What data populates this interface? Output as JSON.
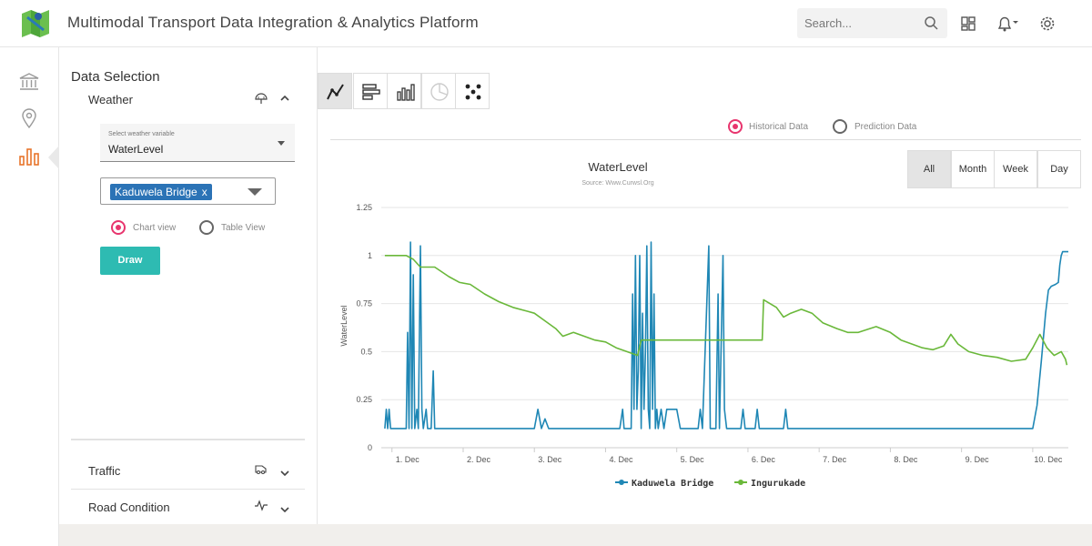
{
  "header": {
    "title": "Multimodal Transport Data Integration & Analytics Platform",
    "search_placeholder": "Search...",
    "icons": [
      "map-logo-icon",
      "search-icon",
      "dashboard-icon",
      "bell-icon",
      "gear-icon"
    ]
  },
  "rail": {
    "items": [
      {
        "icon": "bank-icon",
        "active": false
      },
      {
        "icon": "location-pin-icon",
        "active": false
      },
      {
        "icon": "bar-chart-icon",
        "active": true
      }
    ],
    "active_color": "#e8752b"
  },
  "panel": {
    "title": "Data Selection",
    "sections": [
      {
        "label": "Weather",
        "icon": "umbrella-icon",
        "expanded": true
      },
      {
        "label": "Traffic",
        "icon": "traffic-icon",
        "expanded": false
      },
      {
        "label": "Road Condition",
        "icon": "pulse-icon",
        "expanded": false
      }
    ],
    "variable_label": "Select weather variable",
    "variable_value": "WaterLevel",
    "selected_location": "Kaduwela Bridge",
    "chip_remove": "x",
    "view_options": [
      "Chart view",
      "Table View"
    ],
    "selected_view": "Chart view",
    "draw_label": "Draw"
  },
  "toolbar": {
    "chart_types": [
      "line-chart-icon",
      "horizontal-bar-icon",
      "bar-chart-icon",
      "pie-chart-icon",
      "scatter-icon"
    ],
    "active": "line-chart-icon"
  },
  "data_modes": [
    "Historical Data",
    "Prediction Data"
  ],
  "selected_mode": "Historical Data",
  "ranges": [
    "All",
    "Month",
    "Week",
    "Day"
  ],
  "selected_range": "All",
  "chart_data": {
    "type": "line",
    "title": "WaterLevel",
    "subtitle": "Source: Www.Curwsl.Org",
    "ylabel": "WaterLevel",
    "xlabel": "",
    "ylim": [
      0,
      1.25
    ],
    "y_ticks": [
      "0",
      "0.25",
      "0.5",
      "0.75",
      "1",
      "1.25"
    ],
    "x_ticks": [
      "1. Dec",
      "2. Dec",
      "3. Dec",
      "4. Dec",
      "5. Dec",
      "6. Dec",
      "7. Dec",
      "8. Dec",
      "9. Dec",
      "10. Dec"
    ],
    "x_range": [
      0.85,
      10.5
    ],
    "legend_position": "bottom-center",
    "grid": true,
    "series": [
      {
        "name": "Kaduwela Bridge",
        "color": "#1f87b5",
        "points": [
          [
            0.9,
            0.1
          ],
          [
            0.92,
            0.2
          ],
          [
            0.94,
            0.1
          ],
          [
            0.96,
            0.2
          ],
          [
            0.98,
            0.1
          ],
          [
            1.2,
            0.1
          ],
          [
            1.22,
            0.6
          ],
          [
            1.24,
            0.1
          ],
          [
            1.26,
            1.07
          ],
          [
            1.28,
            0.1
          ],
          [
            1.3,
            0.9
          ],
          [
            1.32,
            0.1
          ],
          [
            1.35,
            0.2
          ],
          [
            1.37,
            0.1
          ],
          [
            1.4,
            1.05
          ],
          [
            1.42,
            0.2
          ],
          [
            1.44,
            0.1
          ],
          [
            1.48,
            0.2
          ],
          [
            1.5,
            0.1
          ],
          [
            1.55,
            0.1
          ],
          [
            1.58,
            0.4
          ],
          [
            1.6,
            0.1
          ],
          [
            2.1,
            0.1
          ],
          [
            3.0,
            0.1
          ],
          [
            3.05,
            0.2
          ],
          [
            3.1,
            0.1
          ],
          [
            3.15,
            0.15
          ],
          [
            3.2,
            0.1
          ],
          [
            4.2,
            0.1
          ],
          [
            4.24,
            0.2
          ],
          [
            4.26,
            0.1
          ],
          [
            4.36,
            0.1
          ],
          [
            4.38,
            0.8
          ],
          [
            4.4,
            0.2
          ],
          [
            4.42,
            1.0
          ],
          [
            4.44,
            0.2
          ],
          [
            4.46,
            0.4
          ],
          [
            4.48,
            1.0
          ],
          [
            4.5,
            0.1
          ],
          [
            4.52,
            0.7
          ],
          [
            4.54,
            0.2
          ],
          [
            4.56,
            0.5
          ],
          [
            4.58,
            1.05
          ],
          [
            4.6,
            0.2
          ],
          [
            4.62,
            0.1
          ],
          [
            4.64,
            1.07
          ],
          [
            4.66,
            0.2
          ],
          [
            4.68,
            0.8
          ],
          [
            4.7,
            0.1
          ],
          [
            4.72,
            0.2
          ],
          [
            4.74,
            0.1
          ],
          [
            4.78,
            0.2
          ],
          [
            4.82,
            0.1
          ],
          [
            4.86,
            0.2
          ],
          [
            5.0,
            0.2
          ],
          [
            5.05,
            0.1
          ],
          [
            5.3,
            0.1
          ],
          [
            5.33,
            0.2
          ],
          [
            5.36,
            0.1
          ],
          [
            5.45,
            1.05
          ],
          [
            5.47,
            0.1
          ],
          [
            5.55,
            0.1
          ],
          [
            5.58,
            0.8
          ],
          [
            5.6,
            0.1
          ],
          [
            5.65,
            1.0
          ],
          [
            5.67,
            0.2
          ],
          [
            5.7,
            0.1
          ],
          [
            5.9,
            0.1
          ],
          [
            5.93,
            0.2
          ],
          [
            5.96,
            0.1
          ],
          [
            6.1,
            0.1
          ],
          [
            6.13,
            0.2
          ],
          [
            6.16,
            0.1
          ],
          [
            6.5,
            0.1
          ],
          [
            6.53,
            0.2
          ],
          [
            6.56,
            0.1
          ],
          [
            10.0,
            0.1
          ],
          [
            10.06,
            0.22
          ],
          [
            10.12,
            0.45
          ],
          [
            10.18,
            0.7
          ],
          [
            10.22,
            0.82
          ],
          [
            10.26,
            0.84
          ],
          [
            10.32,
            0.85
          ],
          [
            10.36,
            0.86
          ],
          [
            10.38,
            0.95
          ],
          [
            10.4,
            1.0
          ],
          [
            10.42,
            1.02
          ],
          [
            10.5,
            1.02
          ]
        ]
      },
      {
        "name": "Ingurukade",
        "color": "#6ab83a",
        "points": [
          [
            0.9,
            1.0
          ],
          [
            1.2,
            1.0
          ],
          [
            1.3,
            0.98
          ],
          [
            1.4,
            0.94
          ],
          [
            1.6,
            0.94
          ],
          [
            1.8,
            0.89
          ],
          [
            1.95,
            0.86
          ],
          [
            2.1,
            0.85
          ],
          [
            2.3,
            0.8
          ],
          [
            2.5,
            0.76
          ],
          [
            2.7,
            0.73
          ],
          [
            2.9,
            0.71
          ],
          [
            3.0,
            0.7
          ],
          [
            3.15,
            0.66
          ],
          [
            3.3,
            0.62
          ],
          [
            3.4,
            0.58
          ],
          [
            3.55,
            0.6
          ],
          [
            3.7,
            0.58
          ],
          [
            3.85,
            0.56
          ],
          [
            4.0,
            0.55
          ],
          [
            4.15,
            0.52
          ],
          [
            4.3,
            0.5
          ],
          [
            4.45,
            0.48
          ],
          [
            4.5,
            0.56
          ],
          [
            6.2,
            0.56
          ],
          [
            6.22,
            0.77
          ],
          [
            6.4,
            0.73
          ],
          [
            6.5,
            0.68
          ],
          [
            6.6,
            0.7
          ],
          [
            6.75,
            0.72
          ],
          [
            6.9,
            0.7
          ],
          [
            7.05,
            0.65
          ],
          [
            7.25,
            0.62
          ],
          [
            7.4,
            0.6
          ],
          [
            7.55,
            0.6
          ],
          [
            7.8,
            0.63
          ],
          [
            8.0,
            0.6
          ],
          [
            8.15,
            0.56
          ],
          [
            8.3,
            0.54
          ],
          [
            8.45,
            0.52
          ],
          [
            8.6,
            0.51
          ],
          [
            8.75,
            0.53
          ],
          [
            8.85,
            0.59
          ],
          [
            8.95,
            0.54
          ],
          [
            9.1,
            0.5
          ],
          [
            9.3,
            0.48
          ],
          [
            9.5,
            0.47
          ],
          [
            9.7,
            0.45
          ],
          [
            9.9,
            0.46
          ],
          [
            10.0,
            0.52
          ],
          [
            10.1,
            0.59
          ],
          [
            10.2,
            0.52
          ],
          [
            10.3,
            0.48
          ],
          [
            10.4,
            0.5
          ],
          [
            10.46,
            0.46
          ],
          [
            10.48,
            0.43
          ]
        ]
      }
    ]
  }
}
